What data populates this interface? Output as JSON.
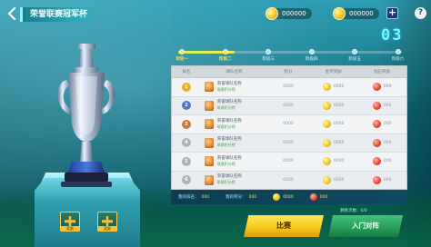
{
  "header": {
    "title": "荣誉联赛冠军杯",
    "back_icon": "chevron-left-icon",
    "currency_a": {
      "icon": "coin-icon",
      "amount": "000000"
    },
    "currency_b": {
      "icon": "coin-icon",
      "amount": "000000"
    },
    "plus_label": "+",
    "help_label": "?"
  },
  "score_display": "03",
  "progress": {
    "fill_fraction": 0.25,
    "steps": [
      {
        "label": "阶段一",
        "active": true
      },
      {
        "label": "阶段二",
        "active": true
      },
      {
        "label": "阶段三",
        "active": false
      },
      {
        "label": "阶段四",
        "active": false
      },
      {
        "label": "阶段五",
        "active": false
      },
      {
        "label": "阶段六",
        "active": false
      }
    ]
  },
  "table": {
    "headers": [
      "排名",
      "球队名称",
      "积分",
      "金币奖励",
      "钻石奖励"
    ],
    "rows": [
      {
        "rank": "1",
        "rank_color": "#e9b21a",
        "team": "荣誉球队名称",
        "sub": "联赛积分榜",
        "score": "0000",
        "gold": "0000",
        "gem": "000"
      },
      {
        "rank": "2",
        "rank_color": "#4f78c8",
        "team": "荣誉球队名称",
        "sub": "联赛积分榜",
        "score": "0000",
        "gold": "0000",
        "gem": "000"
      },
      {
        "rank": "3",
        "rank_color": "#c97b3a",
        "team": "荣誉球队名称",
        "sub": "联赛积分榜",
        "score": "0000",
        "gold": "0000",
        "gem": "000"
      },
      {
        "rank": "4",
        "rank_color": "#a8b2bb",
        "team": "荣誉球队名称",
        "sub": "联赛积分榜",
        "score": "0000",
        "gold": "0000",
        "gem": "000"
      },
      {
        "rank": "5",
        "rank_color": "#a8b2bb",
        "team": "荣誉球队名称",
        "sub": "联赛积分榜",
        "score": "0000",
        "gold": "0000",
        "gem": "000"
      },
      {
        "rank": "6",
        "rank_color": "#a8b2bb",
        "team": "荣誉球队名称",
        "sub": "联赛积分榜",
        "score": "0000",
        "gold": "0000",
        "gem": "000"
      }
    ]
  },
  "footer": {
    "my_rank_label": "我的排名：",
    "my_rank_value": "000",
    "my_score_label": "我的积分：",
    "my_score_value": "000",
    "gold_value": "0000",
    "gem_value": "000"
  },
  "buttons": {
    "primary": "比赛",
    "secondary": "入门对阵",
    "secondary_tip": "剩余次数：0/0"
  },
  "rewards": {
    "box_1_label": "奖励",
    "box_2_label": "奖励"
  },
  "colors": {
    "accent_yellow": "#f7c81c",
    "accent_green": "#259c57",
    "score_cyan": "#7ef2ff"
  }
}
